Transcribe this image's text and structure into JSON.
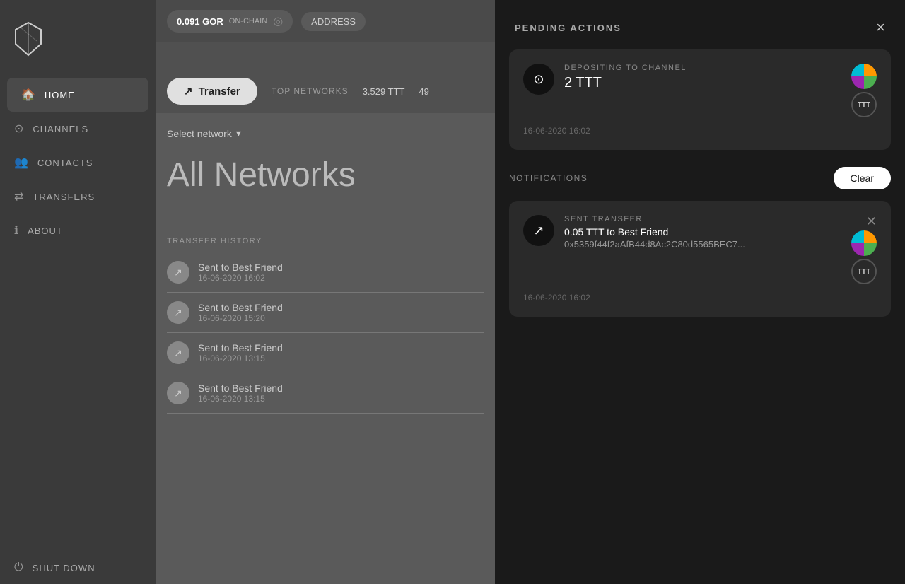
{
  "sidebar": {
    "logo_alt": "App logo",
    "nav_items": [
      {
        "id": "home",
        "label": "HOME",
        "icon": "🏠",
        "active": true
      },
      {
        "id": "channels",
        "label": "CHANNELS",
        "icon": "⊙"
      },
      {
        "id": "contacts",
        "label": "CONTACTS",
        "icon": "👥"
      },
      {
        "id": "transfers",
        "label": "TRANSFERS",
        "icon": "⇄"
      },
      {
        "id": "about",
        "label": "ABOUT",
        "icon": "ℹ"
      }
    ],
    "bottom_nav": [
      {
        "id": "shutdown",
        "label": "SHUT DOWN",
        "icon": "⏻"
      }
    ]
  },
  "topbar": {
    "balance": "0.091",
    "currency": "GOR",
    "chain": "ON-CHAIN",
    "address_label": "ADDRESS"
  },
  "transfer_bar": {
    "button_label": "Transfer",
    "top_networks_label": "TOP NETWORKS",
    "amount": "3.529 TTT",
    "number": "49"
  },
  "main": {
    "network_selector_label": "Select network",
    "all_networks_title": "All Networks",
    "transfer_history_label": "TRANSFER HISTORY",
    "history_items": [
      {
        "name": "Sent to Best Friend",
        "date": "16-06-2020 16:02"
      },
      {
        "name": "Sent to Best Friend",
        "date": "16-06-2020 15:20"
      },
      {
        "name": "Sent to Best Friend",
        "date": "16-06-2020 13:15"
      },
      {
        "name": "Sent to Best Friend",
        "date": "16-06-2020 13:15"
      }
    ]
  },
  "panel": {
    "title": "PENDING ACTIONS",
    "close_label": "×",
    "deposit_card": {
      "icon": "⊙",
      "label": "DEPOSITING TO CHANNEL",
      "amount": "2 TTT",
      "timestamp": "16-06-2020 16:02"
    },
    "notifications_label": "NOTIFICATIONS",
    "clear_button_label": "Clear",
    "sent_card": {
      "icon": "↗",
      "label": "SENT TRANSFER",
      "amount": "0.05 TTT to Best Friend",
      "address": "0x5359f44f2aAfB44d8Ac2C80d5565BEC7...",
      "timestamp": "16-06-2020 16:02"
    }
  }
}
